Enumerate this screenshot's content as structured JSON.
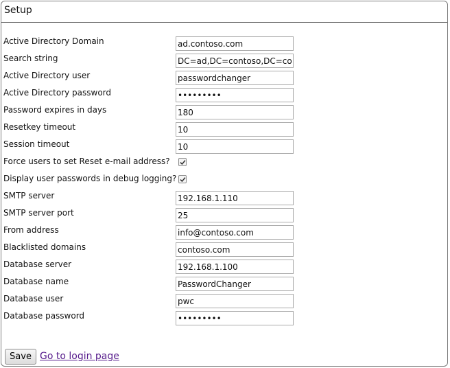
{
  "setup": {
    "title": "Setup"
  },
  "fields": {
    "ad_domain": {
      "label": "Active Directory Domain",
      "value": "ad.contoso.com"
    },
    "search_string": {
      "label": "Search string",
      "value": "DC=ad,DC=contoso,DC=com"
    },
    "ad_user": {
      "label": "Active Directory user",
      "value": "passwordchanger"
    },
    "ad_password": {
      "label": "Active Directory password",
      "value": "•••••••••"
    },
    "pw_expires": {
      "label": "Password expires in days",
      "value": "180"
    },
    "resetkey_timeout": {
      "label": "Resetkey timeout",
      "value": "10"
    },
    "session_timeout": {
      "label": "Session timeout",
      "value": "10"
    },
    "force_reset_email": {
      "label": "Force users to set Reset e-mail address?",
      "checked": true
    },
    "display_pw_debug": {
      "label": "Display user passwords in debug logging?",
      "checked": true
    },
    "smtp_server": {
      "label": "SMTP server",
      "value": "192.168.1.110"
    },
    "smtp_port": {
      "label": "SMTP server port",
      "value": "25"
    },
    "from_address": {
      "label": "From address",
      "value": "info@contoso.com"
    },
    "blacklisted_domains": {
      "label": "Blacklisted domains",
      "value": "contoso.com"
    },
    "db_server": {
      "label": "Database server",
      "value": "192.168.1.100"
    },
    "db_name": {
      "label": "Database name",
      "value": "PasswordChanger"
    },
    "db_user": {
      "label": "Database user",
      "value": "pwc"
    },
    "db_password": {
      "label": "Database password",
      "value": "•••••••••"
    }
  },
  "actions": {
    "save_label": "Save",
    "login_link": "Go to login page"
  },
  "colors": {
    "link": "#551a8b",
    "border": "#7a7a7a"
  }
}
